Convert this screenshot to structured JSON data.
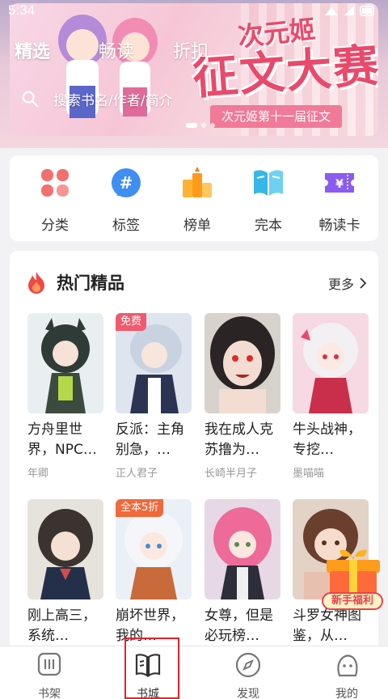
{
  "status_bar": {
    "time": "5:34"
  },
  "header": {
    "tabs": [
      {
        "label": "精选",
        "active": true
      },
      {
        "label": "畅读",
        "active": false
      },
      {
        "label": "折扣",
        "active": false
      }
    ],
    "search_placeholder": "搜索书名/作者/简介",
    "banner": {
      "brand": "次元姬",
      "title": "征文大赛",
      "subtitle": "次元姬第十一届征文",
      "slides": 3,
      "active_slide": 0
    }
  },
  "categories": [
    {
      "label": "分类",
      "icon": "clover-icon"
    },
    {
      "label": "标签",
      "icon": "hashtag-icon"
    },
    {
      "label": "榜单",
      "icon": "ranking-icon"
    },
    {
      "label": "完本",
      "icon": "open-book-icon"
    },
    {
      "label": "畅读卡",
      "icon": "ticket-icon"
    }
  ],
  "hot": {
    "title": "热门精品",
    "more": "更多",
    "books": [
      {
        "title": "方舟里世界，NPC…",
        "author": "年卿",
        "badge": ""
      },
      {
        "title": "反派：主角别急，…",
        "author": "正人君子",
        "badge": "免费"
      },
      {
        "title": "我在成人克苏撸为…",
        "author": "长崎半月子",
        "badge": ""
      },
      {
        "title": "牛头战神，专挖…",
        "author": "墨喵喵",
        "badge": ""
      },
      {
        "title": "刚上高三，系统…",
        "author": "",
        "badge": ""
      },
      {
        "title": "崩坏世界，我的…",
        "author": "",
        "badge": "全本5折"
      },
      {
        "title": "女尊，但是必玩榜…",
        "author": "",
        "badge": ""
      },
      {
        "title": "斗罗女神图鉴，从…",
        "author": "",
        "badge": ""
      }
    ]
  },
  "gift": {
    "label": "新手福利"
  },
  "bottom_nav": [
    {
      "label": "书架",
      "active": false
    },
    {
      "label": "书城",
      "active": true
    },
    {
      "label": "发现",
      "active": false
    },
    {
      "label": "我的",
      "active": false
    }
  ],
  "colors": {
    "accent": "#f05a6e",
    "banner_pink": "#e94a6b",
    "highlight": "#e0232e"
  }
}
